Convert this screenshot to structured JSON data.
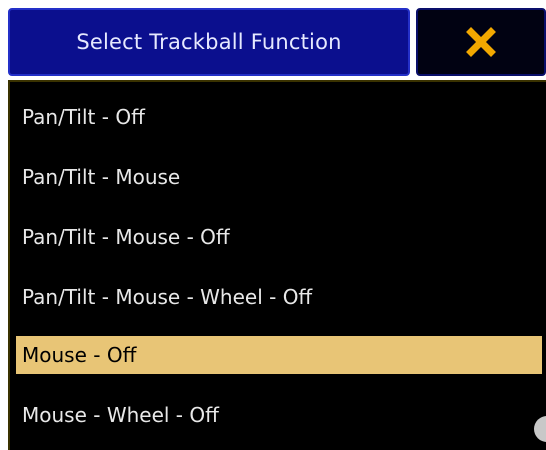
{
  "dialog": {
    "title": "Select Trackball Function",
    "close_icon": "close-icon",
    "close_icon_color": "#f2a800"
  },
  "options": [
    {
      "label": "Pan/Tilt - Off",
      "selected": false
    },
    {
      "label": "Pan/Tilt - Mouse",
      "selected": false
    },
    {
      "label": "Pan/Tilt - Mouse - Off",
      "selected": false
    },
    {
      "label": "Pan/Tilt - Mouse - Wheel - Off",
      "selected": false
    },
    {
      "label": "Mouse - Off",
      "selected": true
    },
    {
      "label": "Mouse - Wheel - Off",
      "selected": false
    }
  ],
  "colors": {
    "title_background": "#0b0f8e",
    "list_background": "#000000",
    "selection_highlight": "#e8c576",
    "item_text": "#e8e8e8"
  }
}
